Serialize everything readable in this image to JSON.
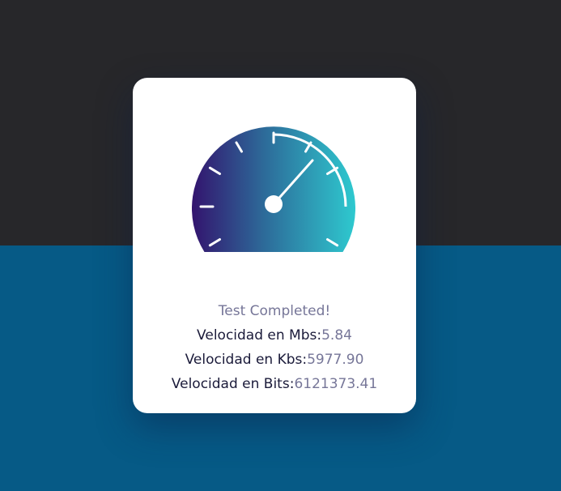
{
  "colors": {
    "background_top": "#27272a",
    "background_bottom": "#065a86",
    "card": "#ffffff",
    "gauge_gradient_start": "#33146e",
    "gauge_gradient_mid": "#2d6c9a",
    "gauge_gradient_end": "#2ec9cf",
    "label_text": "#1b1b3a",
    "value_text": "#767698"
  },
  "gauge": {
    "icon": "speedometer-icon"
  },
  "result": {
    "status": "Test Completed!",
    "mbs_label": "Velocidad en Mbs:",
    "mbs_value": "5.84",
    "kbs_label": "Velocidad en Kbs:",
    "kbs_value": "5977.90",
    "bits_label": "Velocidad en Bits:",
    "bits_value": "6121373.41"
  }
}
